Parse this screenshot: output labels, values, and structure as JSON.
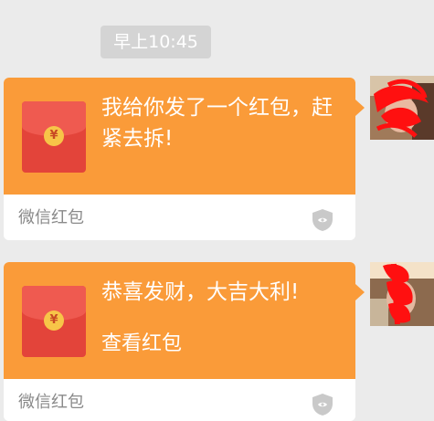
{
  "chat": {
    "timestamp": "早上10:45",
    "messages": [
      {
        "title": "我给你发了一个红包，赶紧去拆!",
        "subtitle": "",
        "service_label": "微信红包",
        "envelope_symbol": "¥",
        "icon": "shield-icon"
      },
      {
        "title": "恭喜发财，大吉大利!",
        "subtitle": "查看红包",
        "service_label": "微信红包",
        "envelope_symbol": "¥",
        "icon": "shield-icon"
      }
    ]
  },
  "colors": {
    "background": "#ebebeb",
    "bubble_orange": "#fa9b39",
    "envelope_red": "#e3443a",
    "envelope_flap": "#ef5a50",
    "coin_gold": "#f7c548",
    "scribble_red": "#ff1010",
    "timestamp_bg": "#d4d4d4"
  }
}
